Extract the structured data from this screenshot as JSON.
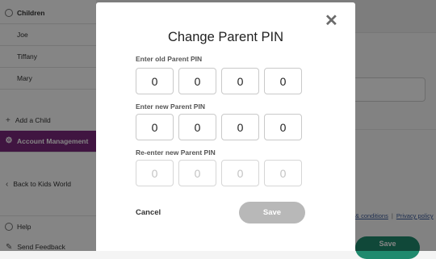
{
  "sidebar": {
    "header": "Children",
    "children": [
      "Joe",
      "Tiffany",
      "Mary"
    ],
    "add_child": "Add a Child",
    "account_management": "Account Management",
    "back": "Back to Kids World",
    "help": "Help",
    "feedback": "Send Feedback"
  },
  "main": {
    "footer_link_1": "& conditions",
    "footer_separator": "|",
    "footer_link_2": "Privacy policy",
    "save_label": "Save"
  },
  "modal": {
    "title": "Change Parent PIN",
    "old_label": "Enter old Parent PIN",
    "old_pin": [
      "0",
      "0",
      "0",
      "0"
    ],
    "new_label": "Enter new Parent PIN",
    "new_pin": [
      "0",
      "0",
      "0",
      "0"
    ],
    "reenter_label": "Re-enter new Parent PIN",
    "reenter_placeholder": [
      "0",
      "0",
      "0",
      "0"
    ],
    "cancel_label": "Cancel",
    "save_label": "Save",
    "close_icon": "close-icon"
  },
  "colors": {
    "accent": "#7b2a7e",
    "save_disabled": "#b8b8b8",
    "bg_save": "#1f8a6e"
  }
}
